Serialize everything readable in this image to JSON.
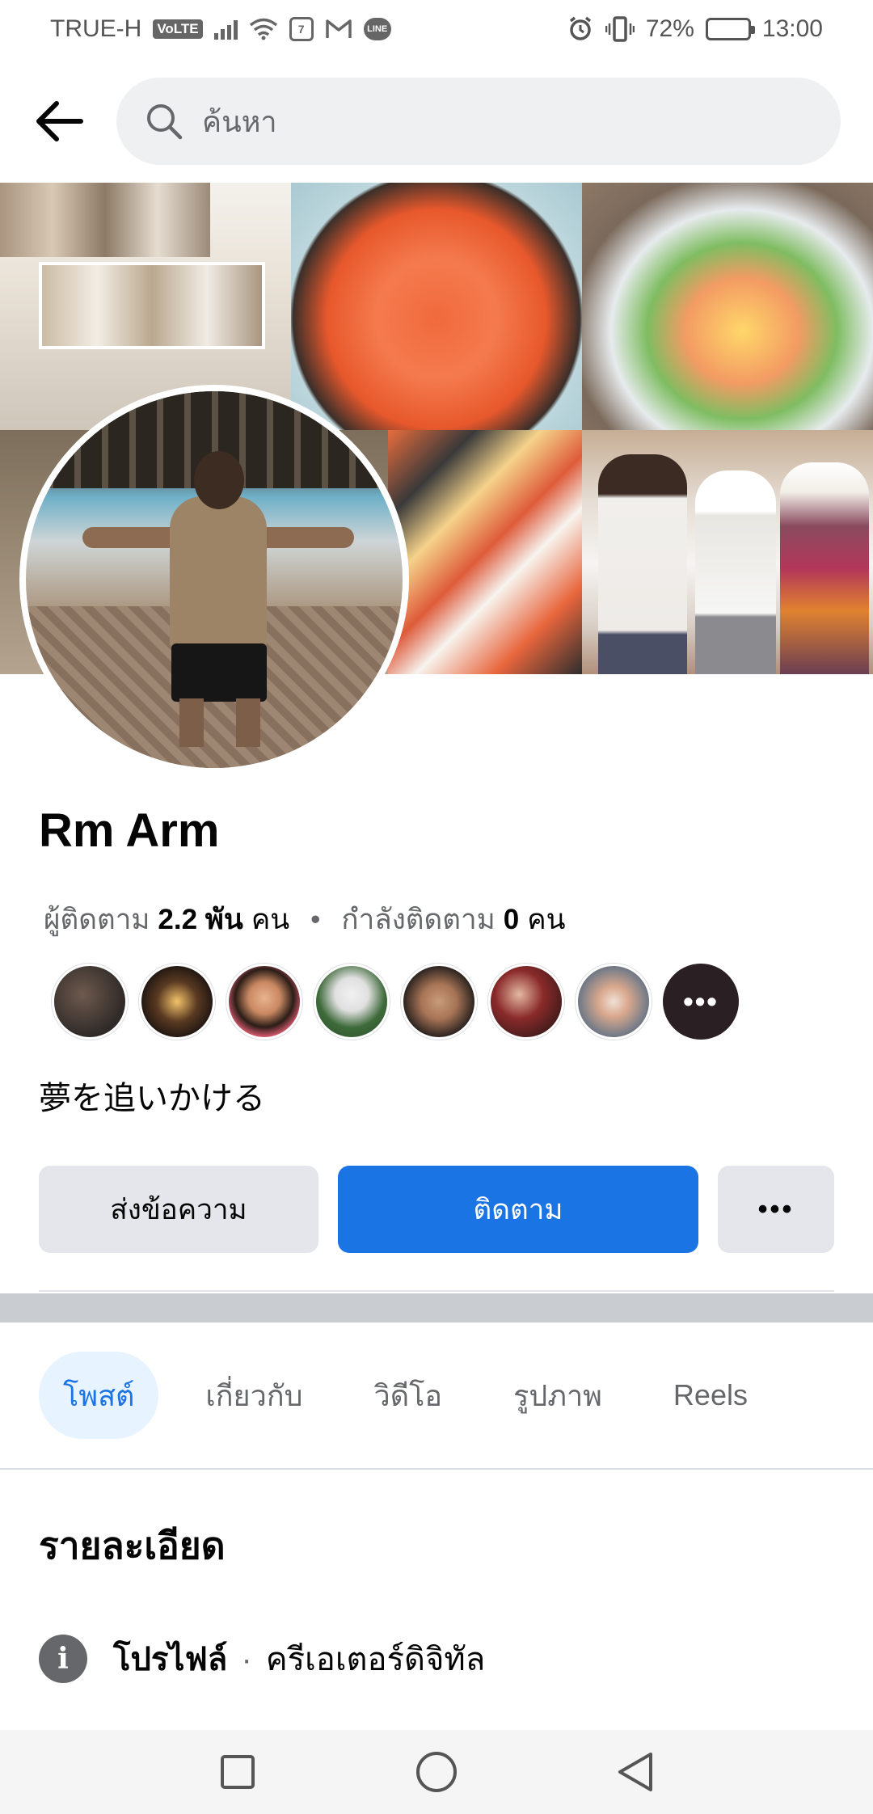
{
  "status_bar": {
    "carrier": "TRUE-H",
    "volte": "VoLTE",
    "battery": "72%",
    "time": "13:00",
    "battery_level": 0.72
  },
  "search": {
    "placeholder": "ค้นหา"
  },
  "profile": {
    "name": "Rm Arm",
    "followers_label": "ผู้ติดตาม",
    "followers_count": "2.2 พัน",
    "followers_unit": "คน",
    "following_label": "กำลังติดตาม",
    "following_count": "0",
    "following_unit": "คน",
    "bio": "夢を追いかける"
  },
  "friends_more_label": "•••",
  "actions": {
    "message": "ส่งข้อความ",
    "follow": "ติดตาม",
    "more": "•••"
  },
  "tabs": [
    {
      "label": "โพสต์",
      "active": true
    },
    {
      "label": "เกี่ยวกับ",
      "active": false
    },
    {
      "label": "วิดีโอ",
      "active": false
    },
    {
      "label": "รูปภาพ",
      "active": false
    },
    {
      "label": "Reels",
      "active": false
    }
  ],
  "details": {
    "title": "รายละเอียด",
    "profile_label": "โปรไฟล์",
    "separator": "·",
    "profile_value": "ครีเอเตอร์ดิจิทัล"
  },
  "colors": {
    "accent": "#1b74e4",
    "tab_active_bg": "#e7f3ff",
    "button_gray": "#e4e6eb",
    "muted_text": "#65676b"
  },
  "icons": {
    "back": "arrow-left-icon",
    "search": "search-icon",
    "info": "info-icon",
    "nav_recent": "square-icon",
    "nav_home": "circle-icon",
    "nav_back": "triangle-back-icon"
  }
}
